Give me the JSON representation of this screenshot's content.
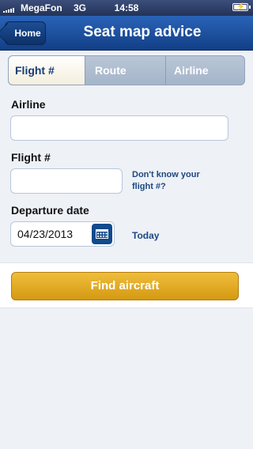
{
  "status_bar": {
    "carrier": "MegaFon",
    "network": "3G",
    "time": "14:58",
    "battery_icon": "battery-charging-icon"
  },
  "nav": {
    "back_label": "Home",
    "title": "Seat map advice"
  },
  "tabs": [
    {
      "label": "Flight #",
      "selected": true
    },
    {
      "label": "Route",
      "selected": false
    },
    {
      "label": "Airline",
      "selected": false
    }
  ],
  "form": {
    "airline_label": "Airline",
    "airline_value": "",
    "flight_label": "Flight #",
    "flight_value": "",
    "flight_hint_line1": "Don't know your",
    "flight_hint_line2": "flight #?",
    "date_label": "Departure date",
    "date_value": "04/23/2013",
    "today_label": "Today"
  },
  "actions": {
    "find_label": "Find aircraft"
  },
  "colors": {
    "nav_blue": "#1f55a6",
    "button_gold": "#e2aa22",
    "link_blue": "#1d4880"
  }
}
